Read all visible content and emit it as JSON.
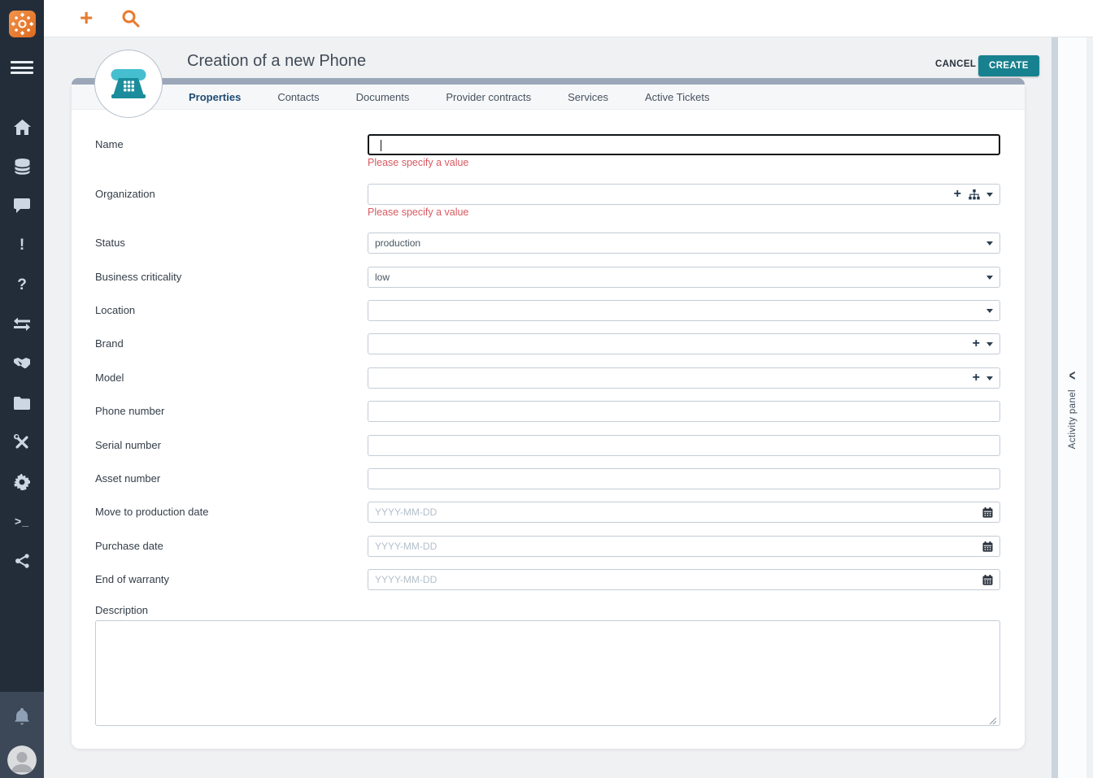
{
  "colors": {
    "accent_orange": "#e87a2e",
    "teal_primary": "#17818f",
    "teal_light": "#45bfcf",
    "error_red": "#d85a62",
    "sidebar_bg": "#232d39",
    "sidebar_footer_bg": "#3c4857",
    "accent_bar": "#9ba7b8",
    "active_tab": "#1f4b72"
  },
  "topbar": {
    "new_object_icon": "plus-icon",
    "search_icon": "magnifier-icon",
    "plus_glyph": "+"
  },
  "sidebar": {
    "logo": "itop-logo",
    "menu_icon": "hamburger-menu",
    "items": [
      "home",
      "data-model",
      "chat",
      "alerts",
      "help",
      "transfer",
      "handshake",
      "documents-folder",
      "tools",
      "settings",
      "terminal",
      "share"
    ],
    "footer_items": [
      "notifications-bell",
      "user-avatar"
    ]
  },
  "header": {
    "title": "Creation of a new Phone",
    "cancel_label": "CANCEL",
    "create_label": "CREATE",
    "object_icon": "phone"
  },
  "tabs": [
    {
      "label": "Properties",
      "active": true
    },
    {
      "label": "Contacts",
      "active": false
    },
    {
      "label": "Documents",
      "active": false
    },
    {
      "label": "Provider contracts",
      "active": false
    },
    {
      "label": "Services",
      "active": false
    },
    {
      "label": "Active Tickets",
      "active": false
    }
  ],
  "form": {
    "fields": [
      {
        "label": "Name",
        "type": "text",
        "value": "",
        "error": "Please specify a value",
        "focused": true
      },
      {
        "label": "Organization",
        "type": "lookup",
        "value": "",
        "error": "Please specify a value",
        "icons": [
          "plus-icon",
          "hierarchy-icon",
          "caret-down-icon"
        ]
      },
      {
        "label": "Status",
        "type": "select",
        "value": "production"
      },
      {
        "label": "Business criticality",
        "type": "select",
        "value": "low"
      },
      {
        "label": "Location",
        "type": "select",
        "value": ""
      },
      {
        "label": "Brand",
        "type": "select-add",
        "value": "",
        "icons": [
          "plus-icon",
          "caret-down-icon"
        ]
      },
      {
        "label": "Model",
        "type": "select-add",
        "value": "",
        "icons": [
          "plus-icon",
          "caret-down-icon"
        ]
      },
      {
        "label": "Phone number",
        "type": "text",
        "value": ""
      },
      {
        "label": "Serial number",
        "type": "text",
        "value": ""
      },
      {
        "label": "Asset number",
        "type": "text",
        "value": ""
      },
      {
        "label": "Move to production date",
        "type": "date",
        "value": "",
        "placeholder": "YYYY-MM-DD"
      },
      {
        "label": "Purchase date",
        "type": "date",
        "value": "",
        "placeholder": "YYYY-MM-DD"
      },
      {
        "label": "End of warranty",
        "type": "date",
        "value": "",
        "placeholder": "YYYY-MM-DD"
      },
      {
        "label": "Description",
        "type": "textarea",
        "value": ""
      }
    ]
  },
  "activity_panel": {
    "label": "Activity panel",
    "collapse_icon": "chevron-left-icon",
    "chevron_glyph": "<"
  }
}
